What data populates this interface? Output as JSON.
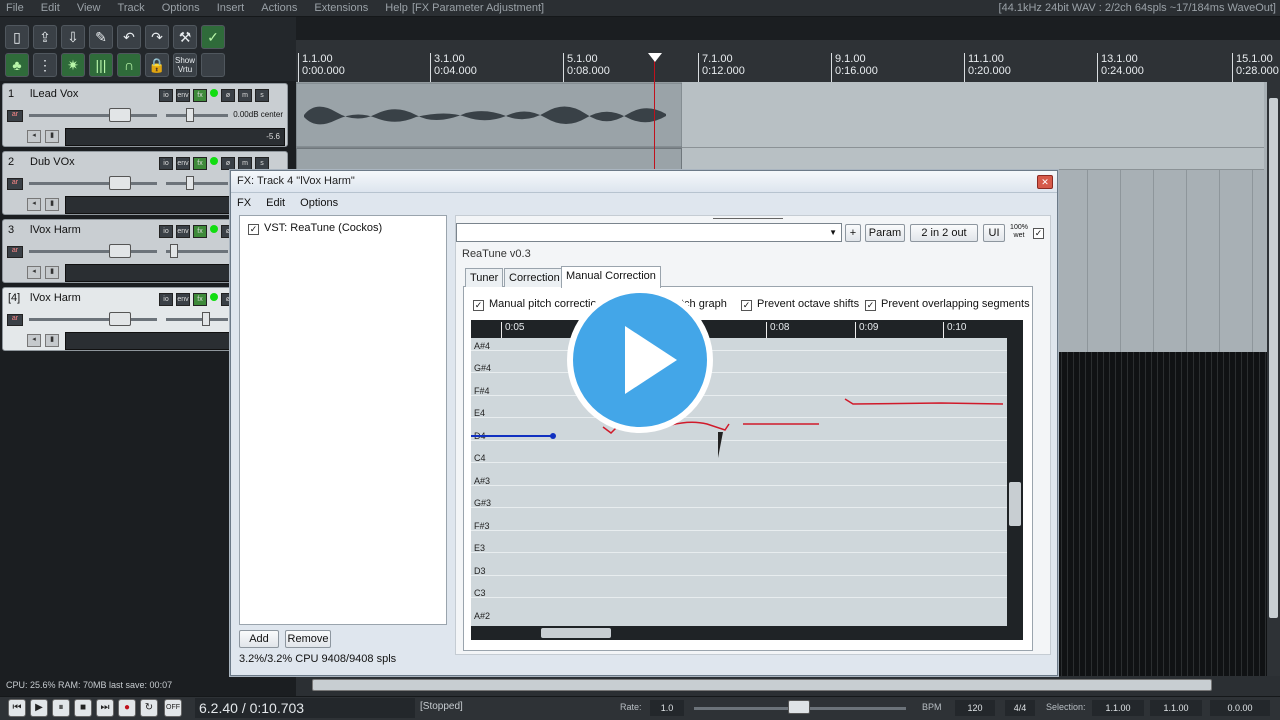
{
  "menu": {
    "items": [
      "File",
      "Edit",
      "View",
      "Track",
      "Options",
      "Insert",
      "Actions",
      "Extensions",
      "Help"
    ],
    "window_title": "[FX Parameter Adjustment]",
    "audio_info": "[44.1kHz 24bit WAV : 2/2ch 64spls ~17/184ms WaveOut]"
  },
  "toolbar": {
    "show_virtual_label": "Show Vrtu"
  },
  "ruler": {
    "marks": [
      {
        "bar": "1.1.00",
        "time": "0:00.000"
      },
      {
        "bar": "3.1.00",
        "time": "0:04.000"
      },
      {
        "bar": "5.1.00",
        "time": "0:08.000"
      },
      {
        "bar": "7.1.00",
        "time": "0:12.000"
      },
      {
        "bar": "9.1.00",
        "time": "0:16.000"
      },
      {
        "bar": "11.1.00",
        "time": "0:20.000"
      },
      {
        "bar": "13.1.00",
        "time": "0:24.000"
      },
      {
        "bar": "15.1.00",
        "time": "0:28.000"
      }
    ]
  },
  "tracks": [
    {
      "num": "1",
      "name": "lLead Vox",
      "vol_label": "0.00dB center",
      "meter": "-5.6"
    },
    {
      "num": "2",
      "name": "Dub VOx",
      "vol_label": "",
      "meter": ""
    },
    {
      "num": "3",
      "name": "lVox Harm",
      "vol_label": "",
      "meter": ""
    },
    {
      "num": "[4]",
      "name": "lVox Harm",
      "vol_label": "",
      "meter": ""
    }
  ],
  "fx_window": {
    "title": "FX: Track 4 \"lVox Harm\"",
    "menu": [
      "FX",
      "Edit",
      "Options"
    ],
    "chain": [
      {
        "name": "VST: ReaTune (Cockos)",
        "enabled": true
      }
    ],
    "add_label": "Add",
    "remove_label": "Remove",
    "cpu_info": "3.2%/3.2% CPU 9408/9408 spls",
    "param_label": "Param",
    "io_label": "2 in 2 out",
    "ui_label": "UI",
    "wet_label": "100% wet",
    "plus_label": "+",
    "plugin_version": "ReaTune v0.3",
    "tabs": [
      "Tuner",
      "Correction",
      "Manual Correction"
    ],
    "active_tab": "Manual Correction",
    "options": [
      {
        "label": "Manual pitch correction",
        "checked": true
      },
      {
        "label": "tch graph",
        "checked": true
      },
      {
        "label": "Prevent octave shifts",
        "checked": true
      },
      {
        "label": "Prevent overlapping segments",
        "checked": true
      }
    ],
    "graph_times": [
      "0:05",
      "0:08",
      "0:09",
      "0:10"
    ],
    "notes": [
      "A#4",
      "G#4",
      "F#4",
      "E4",
      "D4",
      "C4",
      "A#3",
      "G#3",
      "F#3",
      "E3",
      "D3",
      "C3",
      "A#2"
    ]
  },
  "status": {
    "cpu_ram": "CPU: 25.6%  RAM: 70MB  last save: 00:07"
  },
  "transport": {
    "position": "6.2.40 / 0:10.703",
    "state": "[Stopped]",
    "rate_label": "Rate:",
    "rate": "1.0",
    "bpm_label": "BPM",
    "bpm": "120",
    "timesig": "4/4",
    "selection_label": "Selection:",
    "sel_start": "1.1.00",
    "sel_end": "1.1.00",
    "sel_len": "0.0.00",
    "off_label": "OFF"
  },
  "colors": {
    "accent_play": "#43a6e8",
    "cursor_red": "#c0121d",
    "pitch_line_red": "#d01a2a",
    "pitch_line_blue": "#1030c0"
  }
}
